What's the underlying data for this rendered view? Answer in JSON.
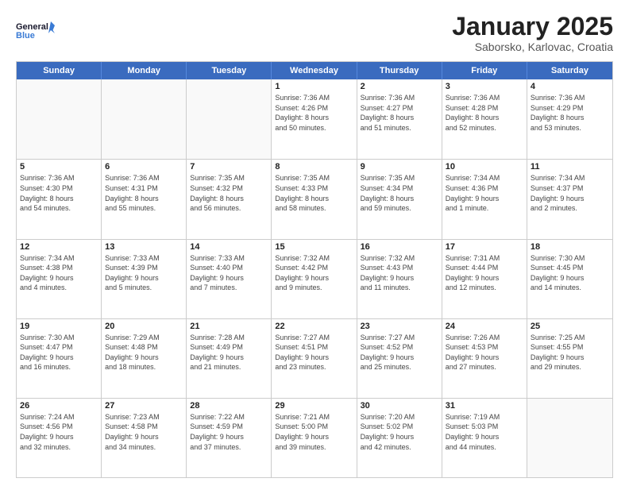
{
  "logo": {
    "line1": "General",
    "line2": "Blue"
  },
  "title": "January 2025",
  "subtitle": "Saborsko, Karlovac, Croatia",
  "weekdays": [
    "Sunday",
    "Monday",
    "Tuesday",
    "Wednesday",
    "Thursday",
    "Friday",
    "Saturday"
  ],
  "weeks": [
    [
      {
        "day": "",
        "info": ""
      },
      {
        "day": "",
        "info": ""
      },
      {
        "day": "",
        "info": ""
      },
      {
        "day": "1",
        "info": "Sunrise: 7:36 AM\nSunset: 4:26 PM\nDaylight: 8 hours\nand 50 minutes."
      },
      {
        "day": "2",
        "info": "Sunrise: 7:36 AM\nSunset: 4:27 PM\nDaylight: 8 hours\nand 51 minutes."
      },
      {
        "day": "3",
        "info": "Sunrise: 7:36 AM\nSunset: 4:28 PM\nDaylight: 8 hours\nand 52 minutes."
      },
      {
        "day": "4",
        "info": "Sunrise: 7:36 AM\nSunset: 4:29 PM\nDaylight: 8 hours\nand 53 minutes."
      }
    ],
    [
      {
        "day": "5",
        "info": "Sunrise: 7:36 AM\nSunset: 4:30 PM\nDaylight: 8 hours\nand 54 minutes."
      },
      {
        "day": "6",
        "info": "Sunrise: 7:36 AM\nSunset: 4:31 PM\nDaylight: 8 hours\nand 55 minutes."
      },
      {
        "day": "7",
        "info": "Sunrise: 7:35 AM\nSunset: 4:32 PM\nDaylight: 8 hours\nand 56 minutes."
      },
      {
        "day": "8",
        "info": "Sunrise: 7:35 AM\nSunset: 4:33 PM\nDaylight: 8 hours\nand 58 minutes."
      },
      {
        "day": "9",
        "info": "Sunrise: 7:35 AM\nSunset: 4:34 PM\nDaylight: 8 hours\nand 59 minutes."
      },
      {
        "day": "10",
        "info": "Sunrise: 7:34 AM\nSunset: 4:36 PM\nDaylight: 9 hours\nand 1 minute."
      },
      {
        "day": "11",
        "info": "Sunrise: 7:34 AM\nSunset: 4:37 PM\nDaylight: 9 hours\nand 2 minutes."
      }
    ],
    [
      {
        "day": "12",
        "info": "Sunrise: 7:34 AM\nSunset: 4:38 PM\nDaylight: 9 hours\nand 4 minutes."
      },
      {
        "day": "13",
        "info": "Sunrise: 7:33 AM\nSunset: 4:39 PM\nDaylight: 9 hours\nand 5 minutes."
      },
      {
        "day": "14",
        "info": "Sunrise: 7:33 AM\nSunset: 4:40 PM\nDaylight: 9 hours\nand 7 minutes."
      },
      {
        "day": "15",
        "info": "Sunrise: 7:32 AM\nSunset: 4:42 PM\nDaylight: 9 hours\nand 9 minutes."
      },
      {
        "day": "16",
        "info": "Sunrise: 7:32 AM\nSunset: 4:43 PM\nDaylight: 9 hours\nand 11 minutes."
      },
      {
        "day": "17",
        "info": "Sunrise: 7:31 AM\nSunset: 4:44 PM\nDaylight: 9 hours\nand 12 minutes."
      },
      {
        "day": "18",
        "info": "Sunrise: 7:30 AM\nSunset: 4:45 PM\nDaylight: 9 hours\nand 14 minutes."
      }
    ],
    [
      {
        "day": "19",
        "info": "Sunrise: 7:30 AM\nSunset: 4:47 PM\nDaylight: 9 hours\nand 16 minutes."
      },
      {
        "day": "20",
        "info": "Sunrise: 7:29 AM\nSunset: 4:48 PM\nDaylight: 9 hours\nand 18 minutes."
      },
      {
        "day": "21",
        "info": "Sunrise: 7:28 AM\nSunset: 4:49 PM\nDaylight: 9 hours\nand 21 minutes."
      },
      {
        "day": "22",
        "info": "Sunrise: 7:27 AM\nSunset: 4:51 PM\nDaylight: 9 hours\nand 23 minutes."
      },
      {
        "day": "23",
        "info": "Sunrise: 7:27 AM\nSunset: 4:52 PM\nDaylight: 9 hours\nand 25 minutes."
      },
      {
        "day": "24",
        "info": "Sunrise: 7:26 AM\nSunset: 4:53 PM\nDaylight: 9 hours\nand 27 minutes."
      },
      {
        "day": "25",
        "info": "Sunrise: 7:25 AM\nSunset: 4:55 PM\nDaylight: 9 hours\nand 29 minutes."
      }
    ],
    [
      {
        "day": "26",
        "info": "Sunrise: 7:24 AM\nSunset: 4:56 PM\nDaylight: 9 hours\nand 32 minutes."
      },
      {
        "day": "27",
        "info": "Sunrise: 7:23 AM\nSunset: 4:58 PM\nDaylight: 9 hours\nand 34 minutes."
      },
      {
        "day": "28",
        "info": "Sunrise: 7:22 AM\nSunset: 4:59 PM\nDaylight: 9 hours\nand 37 minutes."
      },
      {
        "day": "29",
        "info": "Sunrise: 7:21 AM\nSunset: 5:00 PM\nDaylight: 9 hours\nand 39 minutes."
      },
      {
        "day": "30",
        "info": "Sunrise: 7:20 AM\nSunset: 5:02 PM\nDaylight: 9 hours\nand 42 minutes."
      },
      {
        "day": "31",
        "info": "Sunrise: 7:19 AM\nSunset: 5:03 PM\nDaylight: 9 hours\nand 44 minutes."
      },
      {
        "day": "",
        "info": ""
      }
    ]
  ]
}
